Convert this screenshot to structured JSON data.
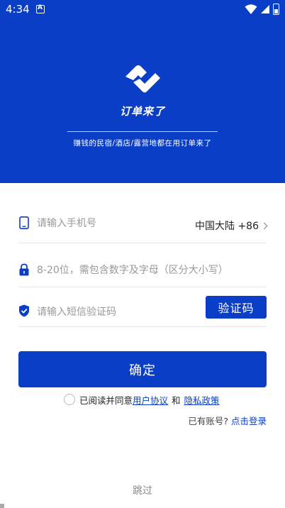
{
  "status_bar": {
    "time": "4:34"
  },
  "header": {
    "brand": "订单来了",
    "slogan": "赚钱的民宿/酒店/露营地都在用订单来了"
  },
  "form": {
    "phone_placeholder": "请输入手机号",
    "country": "中国大陆 +86",
    "password_placeholder": "8-20位，需包含数字及字母（区分大小写）",
    "sms_placeholder": "请输入短信验证码",
    "code_button": "验证码"
  },
  "confirm_label": "确定",
  "agreement": {
    "prefix": "已阅读并同意",
    "user_agreement": "用户协议",
    "and": "和",
    "privacy_policy": "隐私政策"
  },
  "login": {
    "prompt": "已有账号?",
    "link": "点击登录"
  },
  "skip_label": "跳过",
  "colors": {
    "brand_blue": "#0a3ec6"
  },
  "icons": [
    "wifi-icon",
    "signal-icon",
    "battery-icon",
    "notification-icon",
    "phone-icon",
    "lock-icon",
    "shield-check-icon",
    "chevron-right-icon"
  ]
}
